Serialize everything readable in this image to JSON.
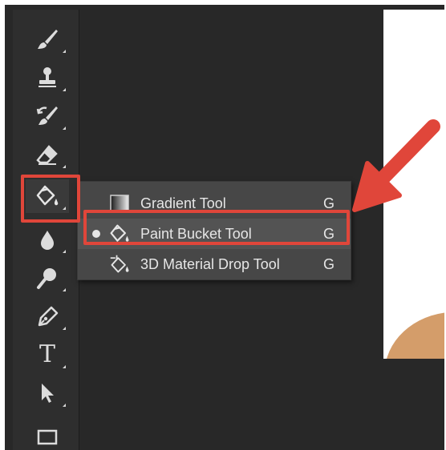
{
  "toolbar": {
    "tools": [
      {
        "name": "brush-icon"
      },
      {
        "name": "clone-stamp-icon"
      },
      {
        "name": "history-brush-icon"
      },
      {
        "name": "eraser-icon"
      },
      {
        "name": "paint-bucket-icon",
        "active": true
      },
      {
        "name": "blur-icon"
      },
      {
        "name": "dodge-icon"
      },
      {
        "name": "pen-icon"
      },
      {
        "name": "type-icon",
        "glyph": "T"
      },
      {
        "name": "path-selection-icon"
      },
      {
        "name": "rectangle-icon"
      }
    ]
  },
  "flyout": {
    "items": [
      {
        "label": "Gradient Tool",
        "shortcut": "G",
        "icon": "gradient-icon",
        "selected": false
      },
      {
        "label": "Paint Bucket Tool",
        "shortcut": "G",
        "icon": "paint-bucket-icon",
        "selected": true
      },
      {
        "label": "3D Material Drop Tool",
        "shortcut": "G",
        "icon": "material-drop-icon",
        "selected": false
      }
    ]
  },
  "colors": {
    "highlight": "#e0463a",
    "panel": "#474747",
    "workspace": "#282828"
  }
}
